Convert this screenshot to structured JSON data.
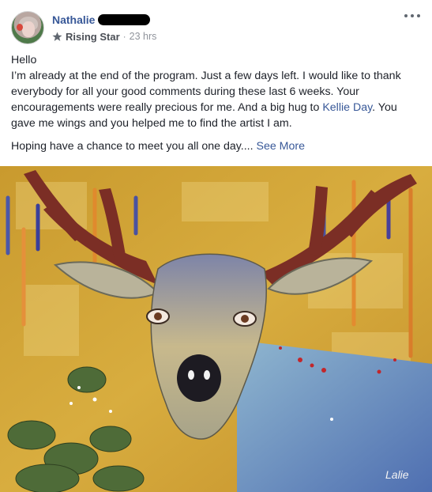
{
  "post": {
    "author": {
      "name": "Nathalie",
      "badge": "Rising Star",
      "separator": "·",
      "time": "23 hrs"
    },
    "message": {
      "line_hello": "Hello",
      "paragraph_part1": "I’m already at the end of the program. Just a few days left. I would like to thank everybody for all your good comments during these last 6 weeks. Your encouragements were really precious for me. And a big hug to ",
      "mention": "Kellie Day",
      "paragraph_part2": ". You gave me wings and you helped me to find the artist I am.",
      "closing": "Hoping have a chance to meet you all one day.... ",
      "see_more": "See More"
    },
    "image": {
      "description_icon": "deer-painting-image",
      "signature": "Lalie"
    }
  }
}
